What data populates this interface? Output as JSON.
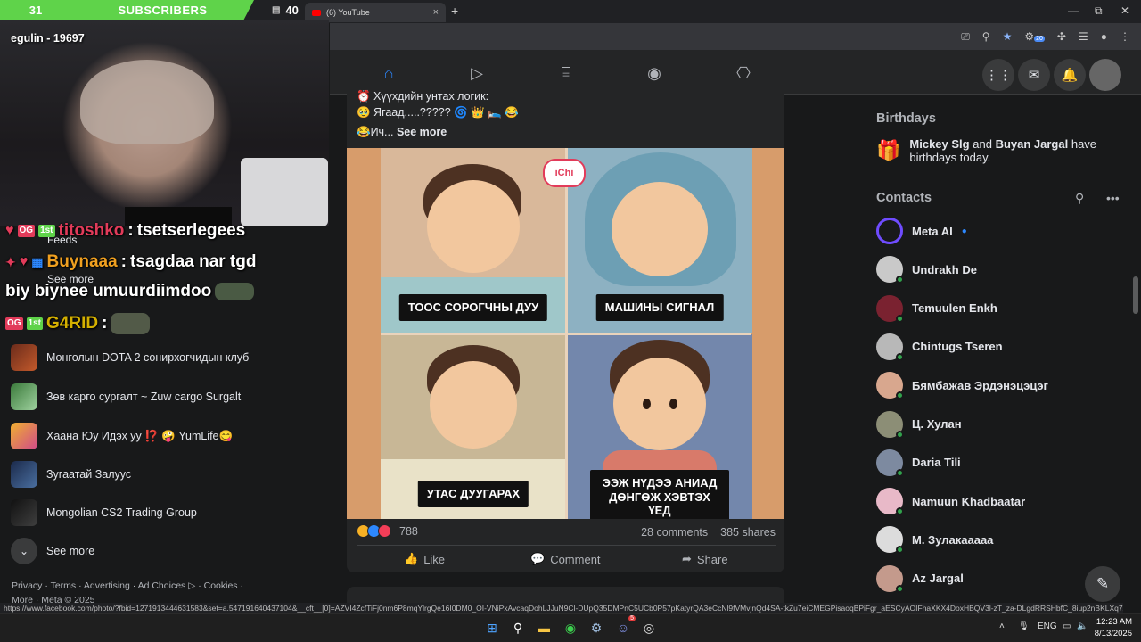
{
  "browser": {
    "tab_title": "(6) YouTube",
    "tab_close": "×",
    "new_tab": "+",
    "extension_badge": "20",
    "win_min": "—",
    "win_max": "⧉",
    "win_close": "✕"
  },
  "overlay": {
    "sub_count": "31",
    "sub_label": "SUBSCRIBERS",
    "viewer_count": "40",
    "streamer_tag": "egulin - 19697",
    "chat": [
      {
        "user": "titoshko",
        "message": "tsetserlegees"
      },
      {
        "user": "Buynaaa",
        "message": "tsagdaa nar tgd"
      },
      {
        "user": "",
        "message": "biy biynee umuurdiimdoo"
      },
      {
        "user": "G4RID",
        "message": ""
      }
    ],
    "badge_og": "OG",
    "badge_first": "1st"
  },
  "sidebar": {
    "feeds_label": "Feeds",
    "see_more_top": "See more",
    "shortcuts": [
      {
        "label": "Монголын DOTA 2 сонирхогчидын клуб"
      },
      {
        "label": "Зөв карго сургалт ~ Zuw cargo Surgalt"
      },
      {
        "label": "Хаана Юу Идэх уу ⁉️ 🤪 YumLife😋"
      },
      {
        "label": "Зугаатай Залуус"
      },
      {
        "label": "Mongolian CS2 Trading Group"
      }
    ],
    "see_more_bottom": "See more",
    "footer_line1": "Privacy · Terms · Advertising · Ad Choices ▷ · Cookies ·",
    "footer_line2": "More · Meta © 2025"
  },
  "post": {
    "line1": "⏰ Хүүхдийн унтах логик:",
    "line2": "🥹 Ягаад.....????? 🌀 👑 🛌 😂",
    "line3_prefix": "😂Ич...",
    "see_more": "See more",
    "logo": "iChi",
    "captions": [
      "ТООС СОРОГЧНЫ ДУУ",
      "МАШИНЫ СИГНАЛ",
      "УТАС ДУУГАРАХ",
      "ЭЭЖ НҮДЭЭ АНИАД ДӨНГӨЖ ХЭВТЭХ ҮЕД"
    ],
    "reaction_count": "788",
    "comments": "28 comments",
    "shares": "385 shares",
    "like": "Like",
    "comment": "Comment",
    "share": "Share"
  },
  "right": {
    "birthdays_heading": "Birthdays",
    "birthday_name1": "Mickey Slg",
    "birthday_and": "and",
    "birthday_name2": "Buyan Jargal",
    "birthday_suffix": "have birthdays today.",
    "contacts_heading": "Contacts",
    "contacts": [
      {
        "name": "Meta AI",
        "color": "#6f4cff"
      },
      {
        "name": "Undrakh De",
        "color": "#c9c9c9"
      },
      {
        "name": "Temuulen Enkh",
        "color": "#7a2230"
      },
      {
        "name": "Chintugs Tseren",
        "color": "#b8b8b8"
      },
      {
        "name": "Бямбажав Эрдэнэцэцэг",
        "color": "#d8a78e"
      },
      {
        "name": "Ц. Хулан",
        "color": "#8c8e76"
      },
      {
        "name": "Daria Tili",
        "color": "#7d8aa0"
      },
      {
        "name": "Namuun Khadbaatar",
        "color": "#e8b9c8"
      },
      {
        "name": "М. Зулакаааaa",
        "color": "#dcdcdc"
      },
      {
        "name": "Az Jargal",
        "color": "#c49a8c"
      }
    ]
  },
  "status_url": "https://www.facebook.com/photo/?fbid=1271913444631583&set=a.547191640437104&__cft__[0]=AZVI4ZcfTiFj0nm6P8mqYlrgQe16I0DM0_OI-VNiPxAvcaqDohLJJuN9Cl-DUpQ35DMPnC5UCb0P57pKatyrQA3eCcNl9fVMvjnQd4SA-tkZu7eiCMEGPisaoqBPiFgr_aESCyAOIFhaXKX4DoxHBQV3l-zT_za-DLgdRRSHbfC_8iup2nBKLXq7ZzzyyIM19Jy4S_M7FAF2Lhk8ur...",
  "taskbar": {
    "lang": "ENG",
    "time": "12:23 AM",
    "date": "8/13/2025",
    "discord_badge": "5"
  }
}
